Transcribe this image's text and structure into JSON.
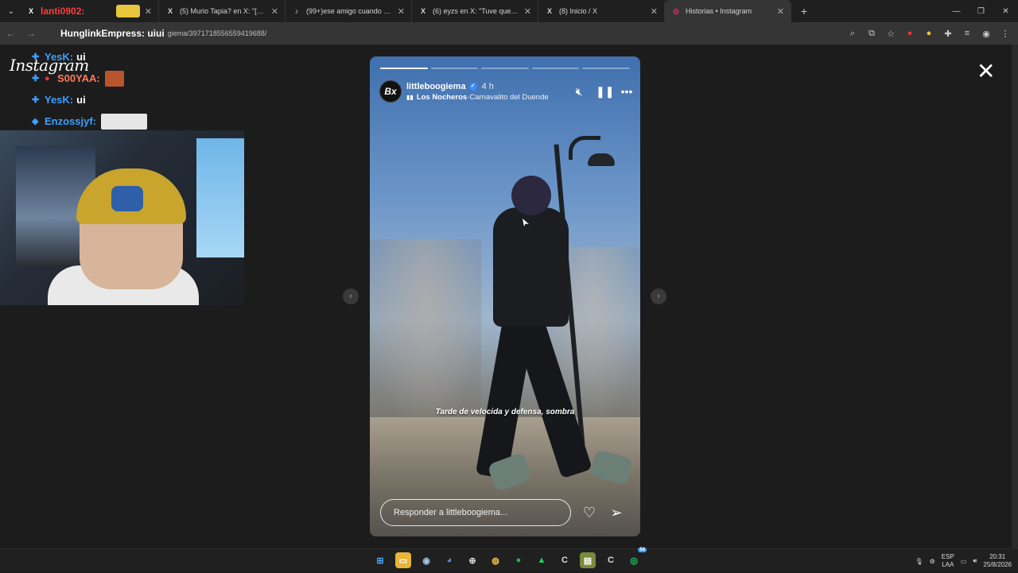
{
  "browser": {
    "tabs": [
      {
        "icon": "X",
        "title": "(5) Murio Tapia? en X: \"[SERIO]",
        "active": false
      },
      {
        "icon": "♪",
        "title": "(99+)ese amigo cuando quiere",
        "active": false
      },
      {
        "icon": "X",
        "title": "(6) eyzs en X: \"Tuve que cortar",
        "active": false
      },
      {
        "icon": "X",
        "title": "(8) Inicio / X",
        "active": false
      },
      {
        "icon": "◎",
        "title": "Historias • Instagram",
        "active": true
      }
    ],
    "first_tab_overlay": "lanti0902:",
    "url": "giema/3971718556559419688/",
    "url_overlay": "HunglinkEmpress: uiui"
  },
  "chat": {
    "lines": [
      {
        "user": "YesK:",
        "msg": "ui",
        "color": "#3aa0ff"
      },
      {
        "user": "S00YAA:",
        "msg": "",
        "color": "#ff7a5c"
      },
      {
        "user": "YesK:",
        "msg": "ui",
        "color": "#3aa0ff"
      },
      {
        "user": "Enzossjyf:",
        "msg": "",
        "color": "#3aa0ff"
      }
    ]
  },
  "instagram": {
    "logo": "Instagram",
    "story": {
      "username": "littleboogiema",
      "avatar_text": "Bx",
      "time": "4 h",
      "music_artist": "Los Nocheros",
      "music_separator": " · ",
      "music_song": "Carnavalito del Duende",
      "caption": "Tarde de velocida y defensa, sombra",
      "reply_placeholder": "Responder a littleboogiema...",
      "progress_segments": 5,
      "progress_done": 1
    },
    "icons": {
      "mute": "muted-speaker-icon",
      "pause": "pause-icon",
      "more": "more-icon",
      "like": "heart-icon",
      "send": "send-icon",
      "close": "close-icon"
    }
  },
  "taskbar": {
    "lang_top": "ESP",
    "lang_bottom": "LAA",
    "time": "20:31",
    "date": "25/8/2026",
    "whatsapp_badge": "54"
  }
}
